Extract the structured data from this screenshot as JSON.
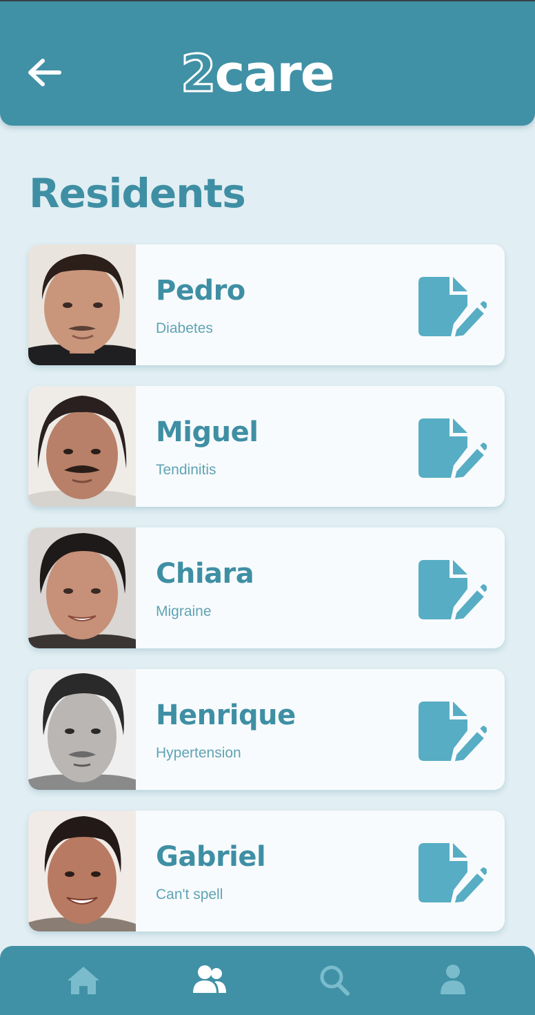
{
  "header": {
    "back_icon": "arrow-left-icon",
    "logo_digit": "2",
    "logo_word": "care"
  },
  "page": {
    "title": "Residents"
  },
  "residents": [
    {
      "name": "Pedro",
      "condition": "Diabetes",
      "action_icon": "edit-document-icon"
    },
    {
      "name": "Miguel",
      "condition": "Tendinitis",
      "action_icon": "edit-document-icon"
    },
    {
      "name": "Chiara",
      "condition": "Migraine",
      "action_icon": "edit-document-icon"
    },
    {
      "name": "Henrique",
      "condition": "Hypertension",
      "action_icon": "edit-document-icon"
    },
    {
      "name": "Gabriel",
      "condition": "Can't spell",
      "action_icon": "edit-document-icon"
    }
  ],
  "bottom_nav": {
    "items": [
      {
        "icon": "home-icon",
        "active": false
      },
      {
        "icon": "users-icon",
        "active": true
      },
      {
        "icon": "search-icon",
        "active": false
      },
      {
        "icon": "user-icon",
        "active": false
      }
    ]
  },
  "colors": {
    "primary": "#4091a6",
    "background": "#e1eef3",
    "card": "#f8fbfd",
    "title_text": "#3f8fa4",
    "subtitle_text": "#5fa3b4",
    "icon_accent": "#57adc3",
    "nav_inactive": "#7bbccc",
    "nav_active": "#ffffff"
  }
}
